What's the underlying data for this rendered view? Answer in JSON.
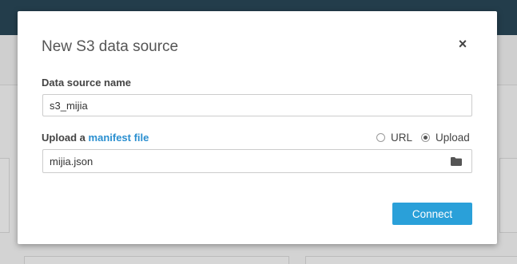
{
  "dialog": {
    "title": "New S3 data source",
    "close_label": "×",
    "data_source_name_label": "Data source name",
    "data_source_name_value": "s3_mijia",
    "upload_label_prefix": "Upload a",
    "manifest_link_label": "manifest file",
    "upload_mode_options": [
      {
        "label": "URL",
        "checked": false
      },
      {
        "label": "Upload",
        "checked": true
      }
    ],
    "file_name": "mijia.json",
    "connect_label": "Connect",
    "accent_color": "#2aa0d9",
    "link_color": "#2a8fd0"
  }
}
